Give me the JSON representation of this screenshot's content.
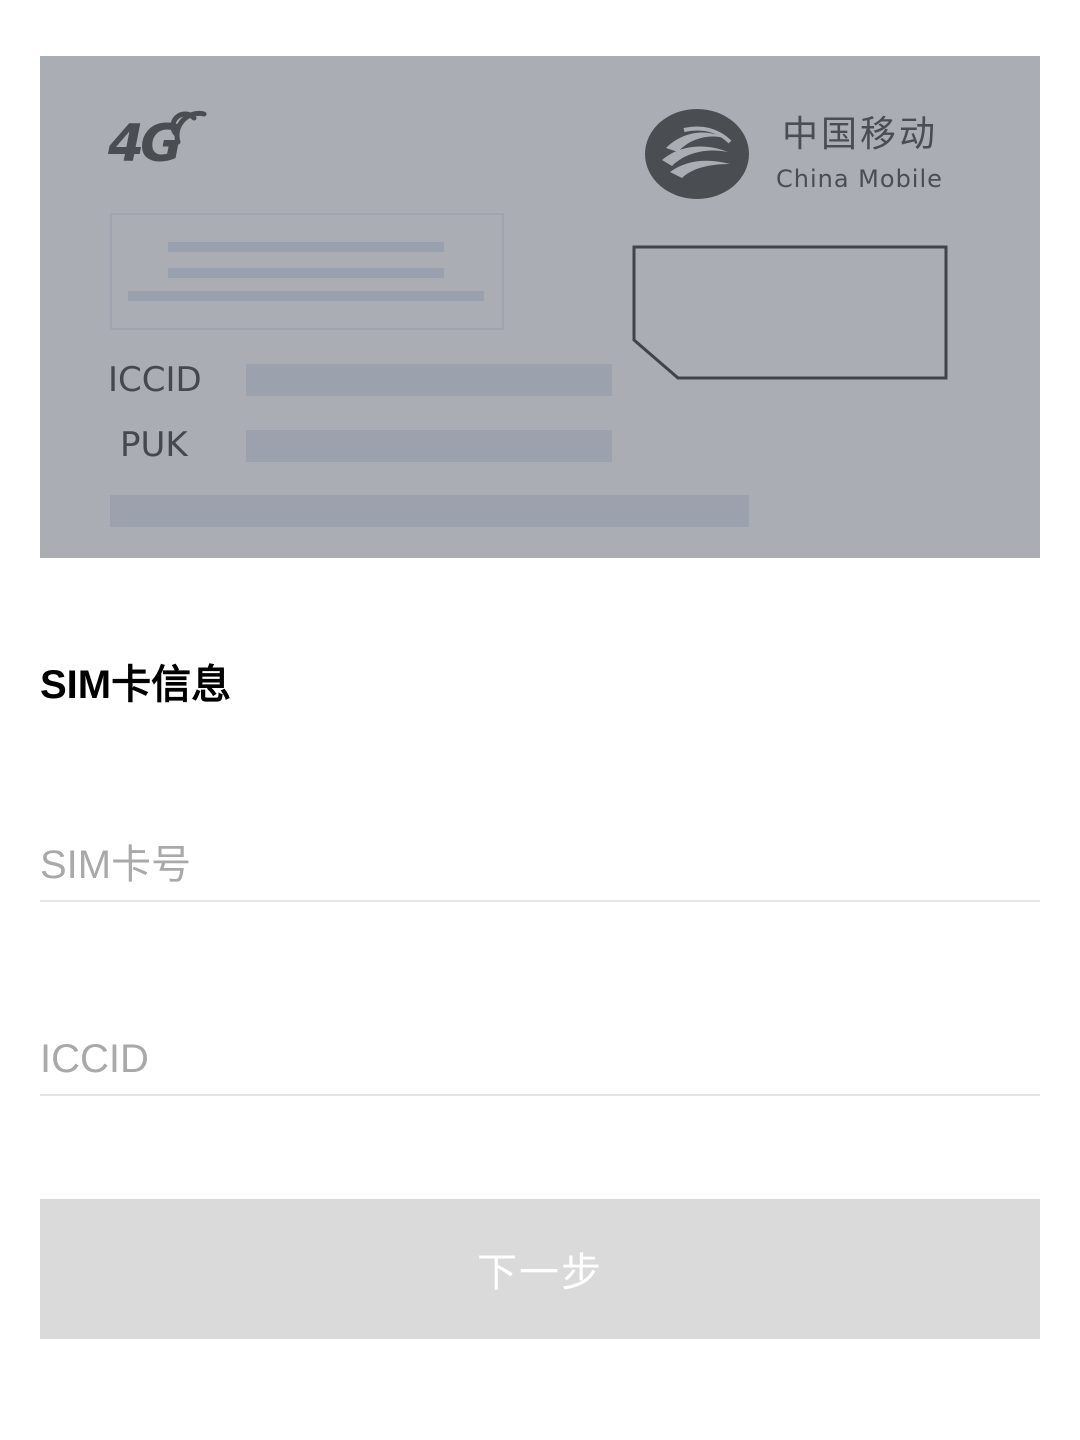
{
  "sim_card_image": {
    "network_badge": "4G",
    "brand_name_cn": "中国移动",
    "brand_name_en": "China Mobile",
    "iccid_label": "ICCID",
    "puk_label": "PUK",
    "logo_icon": "china-mobile-logo",
    "chip_icon": "sim-chip-outline"
  },
  "form": {
    "section_title": "SIM卡信息",
    "sim_number_placeholder": "SIM卡号",
    "iccid_placeholder": "ICCID",
    "next_label": "下一步"
  },
  "colors": {
    "card_background": "#aaaeb4",
    "button_disabled": "#dadada",
    "divider": "#e5e5e5"
  }
}
